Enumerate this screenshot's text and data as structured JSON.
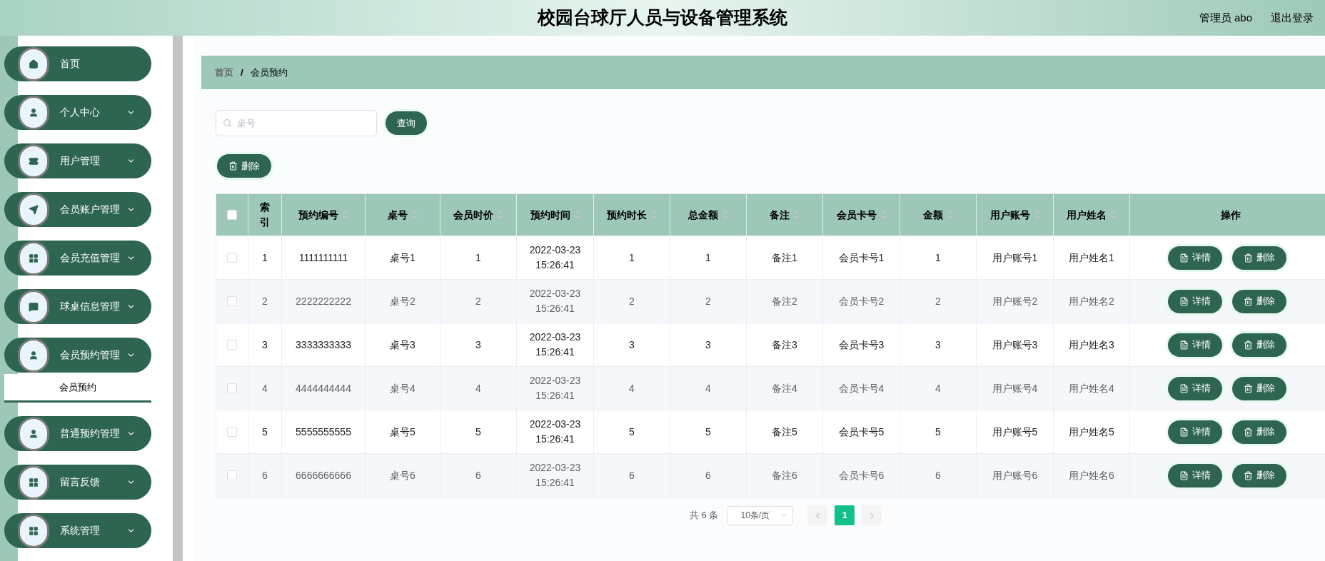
{
  "header": {
    "title": "校园台球厅人员与设备管理系统",
    "user": "管理员 abo",
    "logout": "退出登录"
  },
  "sidebar": {
    "items": [
      {
        "label": "首页",
        "kind": "link"
      },
      {
        "label": "个人中心",
        "kind": "menu"
      },
      {
        "label": "用户管理",
        "kind": "menu"
      },
      {
        "label": "会员账户管理",
        "kind": "menu"
      },
      {
        "label": "会员充值管理",
        "kind": "menu"
      },
      {
        "label": "球桌信息管理",
        "kind": "menu"
      },
      {
        "label": "会员预约管理",
        "kind": "menu",
        "children": [
          {
            "label": "会员预约",
            "selected": true
          }
        ]
      },
      {
        "label": "普通预约管理",
        "kind": "menu"
      },
      {
        "label": "留言反馈",
        "kind": "menu"
      },
      {
        "label": "系统管理",
        "kind": "menu"
      }
    ]
  },
  "breadcrumb": {
    "items": [
      "首页",
      "会员预约"
    ],
    "separator": "/"
  },
  "search": {
    "placeholder": "桌号",
    "button": "查询"
  },
  "delete_button": "删除",
  "table": {
    "select_all": {
      "checked": false
    },
    "columns": [
      {
        "label": "索引",
        "sortable": false
      },
      {
        "label": "预约编号",
        "sortable": true
      },
      {
        "label": "桌号",
        "sortable": true
      },
      {
        "label": "会员时价",
        "sortable": true
      },
      {
        "label": "预约时间",
        "sortable": true
      },
      {
        "label": "预约时长",
        "sortable": true
      },
      {
        "label": "总金额",
        "sortable": true
      },
      {
        "label": "备注",
        "sortable": true
      },
      {
        "label": "会员卡号",
        "sortable": true
      },
      {
        "label": "金额",
        "sortable": true
      },
      {
        "label": "用户账号",
        "sortable": true
      },
      {
        "label": "用户姓名",
        "sortable": true
      },
      {
        "label": "操作",
        "sortable": false
      }
    ],
    "rows": [
      {
        "checked": false,
        "cells": [
          "1",
          "1111111111",
          "桌号1",
          "1",
          "2022-03-23 15:26:41",
          "1",
          "1",
          "备注1",
          "会员卡号1",
          "1",
          "用户账号1",
          "用户姓名1"
        ],
        "actions": [
          "详情",
          "删除"
        ]
      },
      {
        "checked": false,
        "cells": [
          "2",
          "2222222222",
          "桌号2",
          "2",
          "2022-03-23 15:26:41",
          "2",
          "2",
          "备注2",
          "会员卡号2",
          "2",
          "用户账号2",
          "用户姓名2"
        ],
        "actions": [
          "详情",
          "删除"
        ]
      },
      {
        "checked": false,
        "cells": [
          "3",
          "3333333333",
          "桌号3",
          "3",
          "2022-03-23 15:26:41",
          "3",
          "3",
          "备注3",
          "会员卡号3",
          "3",
          "用户账号3",
          "用户姓名3"
        ],
        "actions": [
          "详情",
          "删除"
        ]
      },
      {
        "checked": false,
        "cells": [
          "4",
          "4444444444",
          "桌号4",
          "4",
          "2022-03-23 15:26:41",
          "4",
          "4",
          "备注4",
          "会员卡号4",
          "4",
          "用户账号4",
          "用户姓名4"
        ],
        "actions": [
          "详情",
          "删除"
        ]
      },
      {
        "checked": false,
        "cells": [
          "5",
          "5555555555",
          "桌号5",
          "5",
          "2022-03-23 15:26:41",
          "5",
          "5",
          "备注5",
          "会员卡号5",
          "5",
          "用户账号5",
          "用户姓名5"
        ],
        "actions": [
          "详情",
          "删除"
        ]
      },
      {
        "checked": false,
        "cells": [
          "6",
          "6666666666",
          "桌号6",
          "6",
          "2022-03-23 15:26:41",
          "6",
          "6",
          "备注6",
          "会员卡号6",
          "6",
          "用户账号6",
          "用户姓名6"
        ],
        "actions": [
          "详情",
          "删除"
        ]
      }
    ]
  },
  "pagination": {
    "total": "共 6 条",
    "page_size": "10条/页",
    "pages": [
      {
        "label": "1",
        "selected": true
      }
    ]
  }
}
